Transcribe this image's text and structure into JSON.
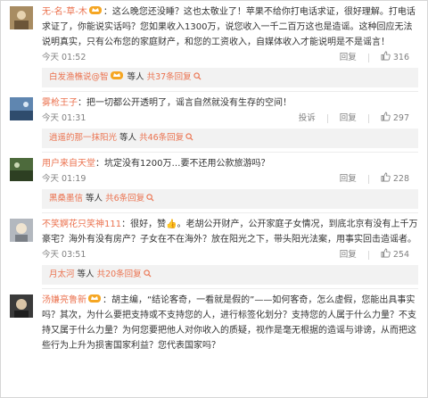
{
  "comments": [
    {
      "user": "无-名-草-木",
      "text": "：这么晚您还没睡？这也太敬业了！苹果不给你打电话求证，很好理解。打电话求证了，你能说实话吗？您如果收入1300万，说您收入一千二百万这也是造谣。这种回应无法说明真实，只有公布您的家庭财产，和您的工资收入，自媒体收入才能说明是不是谣言！",
      "time": "今天 01:52",
      "reply_label": "回复",
      "likes": "316",
      "sub_reply": {
        "name": "白发渔樵说@智",
        "mid": "等人",
        "count": "共37条回复"
      }
    },
    {
      "user": "雾枪王子",
      "text": "：把一切都公开透明了，谣言自然就没有生存的空间！",
      "time": "今天 01:31",
      "report_label": "投诉",
      "reply_label": "回复",
      "likes": "297",
      "sub_reply": {
        "name": "逍遥的那一抹阳光",
        "mid": "等人",
        "count": "共46条回复"
      }
    },
    {
      "user": "用户来自天堂",
      "text": "：坑定没有1200万…要不还用公款旅游吗？",
      "time": "今天 01:19",
      "reply_label": "回复",
      "likes": "228",
      "sub_reply": {
        "name": "黑桑墨信",
        "mid": "等人",
        "count": "共6条回复"
      }
    },
    {
      "user": "不笑婀花只笑神111",
      "text": "：很好，赞👍。老胡公开财产，公开家庭子女情况，到底北京有没有上千万豪宅？海外有没有房产？子女在不在海外？放在阳光之下，带头阳光法案，用事实回击造谣者。",
      "time": "今天 03:51",
      "reply_label": "回复",
      "likes": "254",
      "sub_reply": {
        "name": "月太河",
        "mid": "等人",
        "count": "共20条回复"
      }
    },
    {
      "user": "汤嫌亮鲁新",
      "text": "：胡主编，“结论客奇，一看就是假的”——如何客奇，怎么虚假，您能出具事实吗？其次，为什么要把支持或不支持您的人，进行标签化划分？支持您的人属于什么力量？不支持又属于什么力量？为何您要把他人对你收入的质疑，视作是毫无根据的造谣与诽谤，从而把这些行为上升为损害国家利益？您代表国家吗？"
    }
  ],
  "colors": {
    "username": "#eb7350",
    "meta": "#808080",
    "reply_bg": "#f2f2f2"
  },
  "icons": [
    "vip-crown-icon",
    "thumb-up-icon",
    "magnifier-icon"
  ]
}
